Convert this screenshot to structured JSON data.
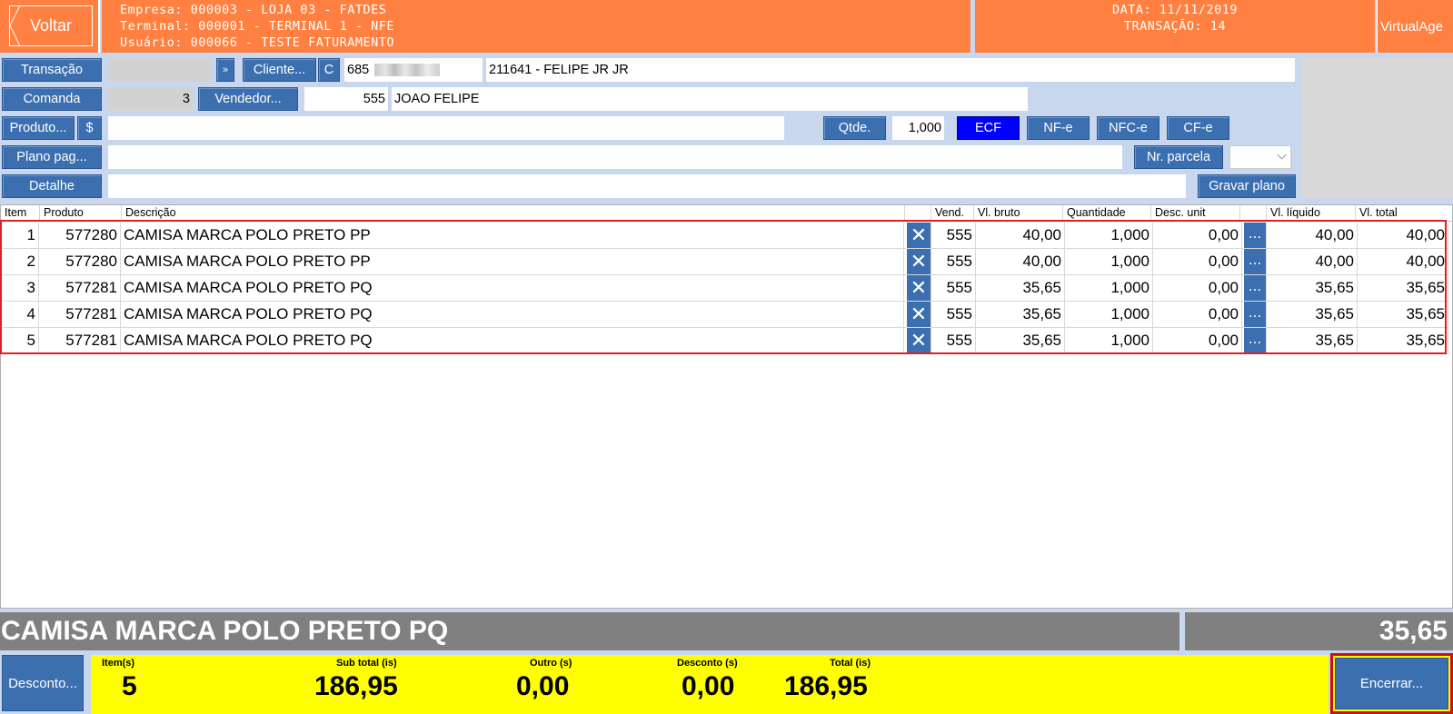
{
  "header": {
    "back_label": "Voltar",
    "empresa": "Empresa: 000003 - LOJA 03 - FATDES",
    "terminal": "Terminal: 000001 - TERMINAL 1 - NFE",
    "usuario": "Usuário: 000066 - TESTE FATURAMENTO",
    "data": "DATA: 11/11/2019",
    "transacao": "TRANSAÇÃO: 14",
    "brand": "VirtualAge"
  },
  "form": {
    "transacao_btn": "Transação",
    "transacao_value": "",
    "next_btn": "»",
    "cliente_btn": "Cliente...",
    "c_btn": "C",
    "cliente_code": "685",
    "cliente_name": "211641 - FELIPE JR JR",
    "comanda_btn": "Comanda",
    "comanda_value": "3",
    "vendedor_btn": "Vendedor...",
    "vendedor_code": "555",
    "vendedor_name": "JOAO FELIPE",
    "produto_btn": "Produto...",
    "dollar_btn": "$",
    "produto_value": "",
    "qtde_btn": "Qtde.",
    "qtde_value": "1,000",
    "ecf_btn": "ECF",
    "nfe_btn": "NF-e",
    "nfce_btn": "NFC-e",
    "cfe_btn": "CF-e",
    "plano_btn": "Plano pag...",
    "plano_value": "",
    "nr_parcela_btn": "Nr. parcela",
    "detalhe_btn": "Detalhe",
    "detalhe_value": "",
    "gravar_btn": "Gravar plano"
  },
  "grid": {
    "columns": [
      "Item",
      "Produto",
      "Descrição",
      "",
      "Vend.",
      "Vl. bruto",
      "Quantidade",
      "Desc. unit",
      "",
      "Vl. líquido",
      "Vl. total"
    ],
    "rows": [
      {
        "item": "1",
        "produto": "577280",
        "descricao": "CAMISA MARCA POLO PRETO PP",
        "x": "✕",
        "vend": "555",
        "vl_bruto": "40,00",
        "quantidade": "1,000",
        "desc_unit": "0,00",
        "dots": "...",
        "vl_liquido": "40,00",
        "vl_total": "40,00"
      },
      {
        "item": "2",
        "produto": "577280",
        "descricao": "CAMISA MARCA POLO PRETO PP",
        "x": "✕",
        "vend": "555",
        "vl_bruto": "40,00",
        "quantidade": "1,000",
        "desc_unit": "0,00",
        "dots": "...",
        "vl_liquido": "40,00",
        "vl_total": "40,00"
      },
      {
        "item": "3",
        "produto": "577281",
        "descricao": "CAMISA MARCA POLO PRETO PQ",
        "x": "✕",
        "vend": "555",
        "vl_bruto": "35,65",
        "quantidade": "1,000",
        "desc_unit": "0,00",
        "dots": "...",
        "vl_liquido": "35,65",
        "vl_total": "35,65"
      },
      {
        "item": "4",
        "produto": "577281",
        "descricao": "CAMISA MARCA POLO PRETO PQ",
        "x": "✕",
        "vend": "555",
        "vl_bruto": "35,65",
        "quantidade": "1,000",
        "desc_unit": "0,00",
        "dots": "...",
        "vl_liquido": "35,65",
        "vl_total": "35,65"
      },
      {
        "item": "5",
        "produto": "577281",
        "descricao": "CAMISA MARCA POLO PRETO PQ",
        "x": "✕",
        "vend": "555",
        "vl_bruto": "35,65",
        "quantidade": "1,000",
        "desc_unit": "0,00",
        "dots": "...",
        "vl_liquido": "35,65",
        "vl_total": "35,65"
      }
    ]
  },
  "current": {
    "descricao": "CAMISA MARCA POLO PRETO PQ",
    "valor": "35,65"
  },
  "footer": {
    "desconto_btn": "Desconto...",
    "itens_label": "Item(s)",
    "itens_value": "5",
    "subtotal_label": "Sub total (is)",
    "subtotal_value": "186,95",
    "outro_label": "Outro (s)",
    "outro_value": "0,00",
    "desconto_label": "Desconto (s)",
    "desconto_value": "0,00",
    "total_label": "Total (is)",
    "total_value": "186,95",
    "encerrar_btn": "Encerrar..."
  },
  "colors": {
    "header_orange": "#ff8040",
    "button_blue": "#3b6fb0",
    "ecf_blue": "#0000ff",
    "totals_yellow": "#ffff00",
    "selection_red": "#e02020",
    "background": "#c8d7ee"
  }
}
